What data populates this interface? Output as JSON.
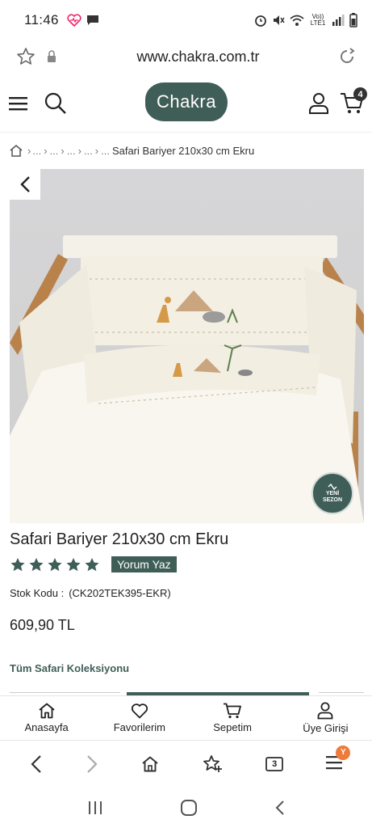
{
  "status_bar": {
    "time": "11:46",
    "network": "Vo)) LTE1",
    "icons": [
      "heart-rate-icon",
      "message-icon",
      "alarm-icon",
      "mute-icon",
      "wifi-icon",
      "signal-icon",
      "battery-icon"
    ]
  },
  "browser": {
    "url": "www.chakra.com.tr",
    "icons": [
      "star-icon",
      "lock-icon",
      "reload-icon"
    ]
  },
  "header": {
    "logo_text": "Chakra",
    "cart_count": "4",
    "brand_color": "#3f5e57"
  },
  "breadcrumb": {
    "items": [
      "...",
      "...",
      "...",
      "...",
      "..."
    ],
    "current": "Safari Bariyer 210x30 cm Ekru"
  },
  "product": {
    "badge_line1": "YENİ",
    "badge_line2": "SEZON",
    "title": "Safari Bariyer 210x30 cm Ekru",
    "rating": 5,
    "review_button": "Yorum Yaz",
    "sku_label": "Stok Kodu :",
    "sku_value": "(CK202TEK395-EKR)",
    "price": "609,90 TL",
    "collection_link": "Tüm Safari Koleksiyonu"
  },
  "site_nav": {
    "items": [
      {
        "label": "Anasayfa",
        "icon": "home-icon"
      },
      {
        "label": "Favorilerim",
        "icon": "heart-icon"
      },
      {
        "label": "Sepetim",
        "icon": "cart-icon"
      },
      {
        "label": "Üye Girişi",
        "icon": "user-icon"
      }
    ]
  },
  "browser_toolbar": {
    "tab_count": "3",
    "menu_badge": "Y"
  }
}
